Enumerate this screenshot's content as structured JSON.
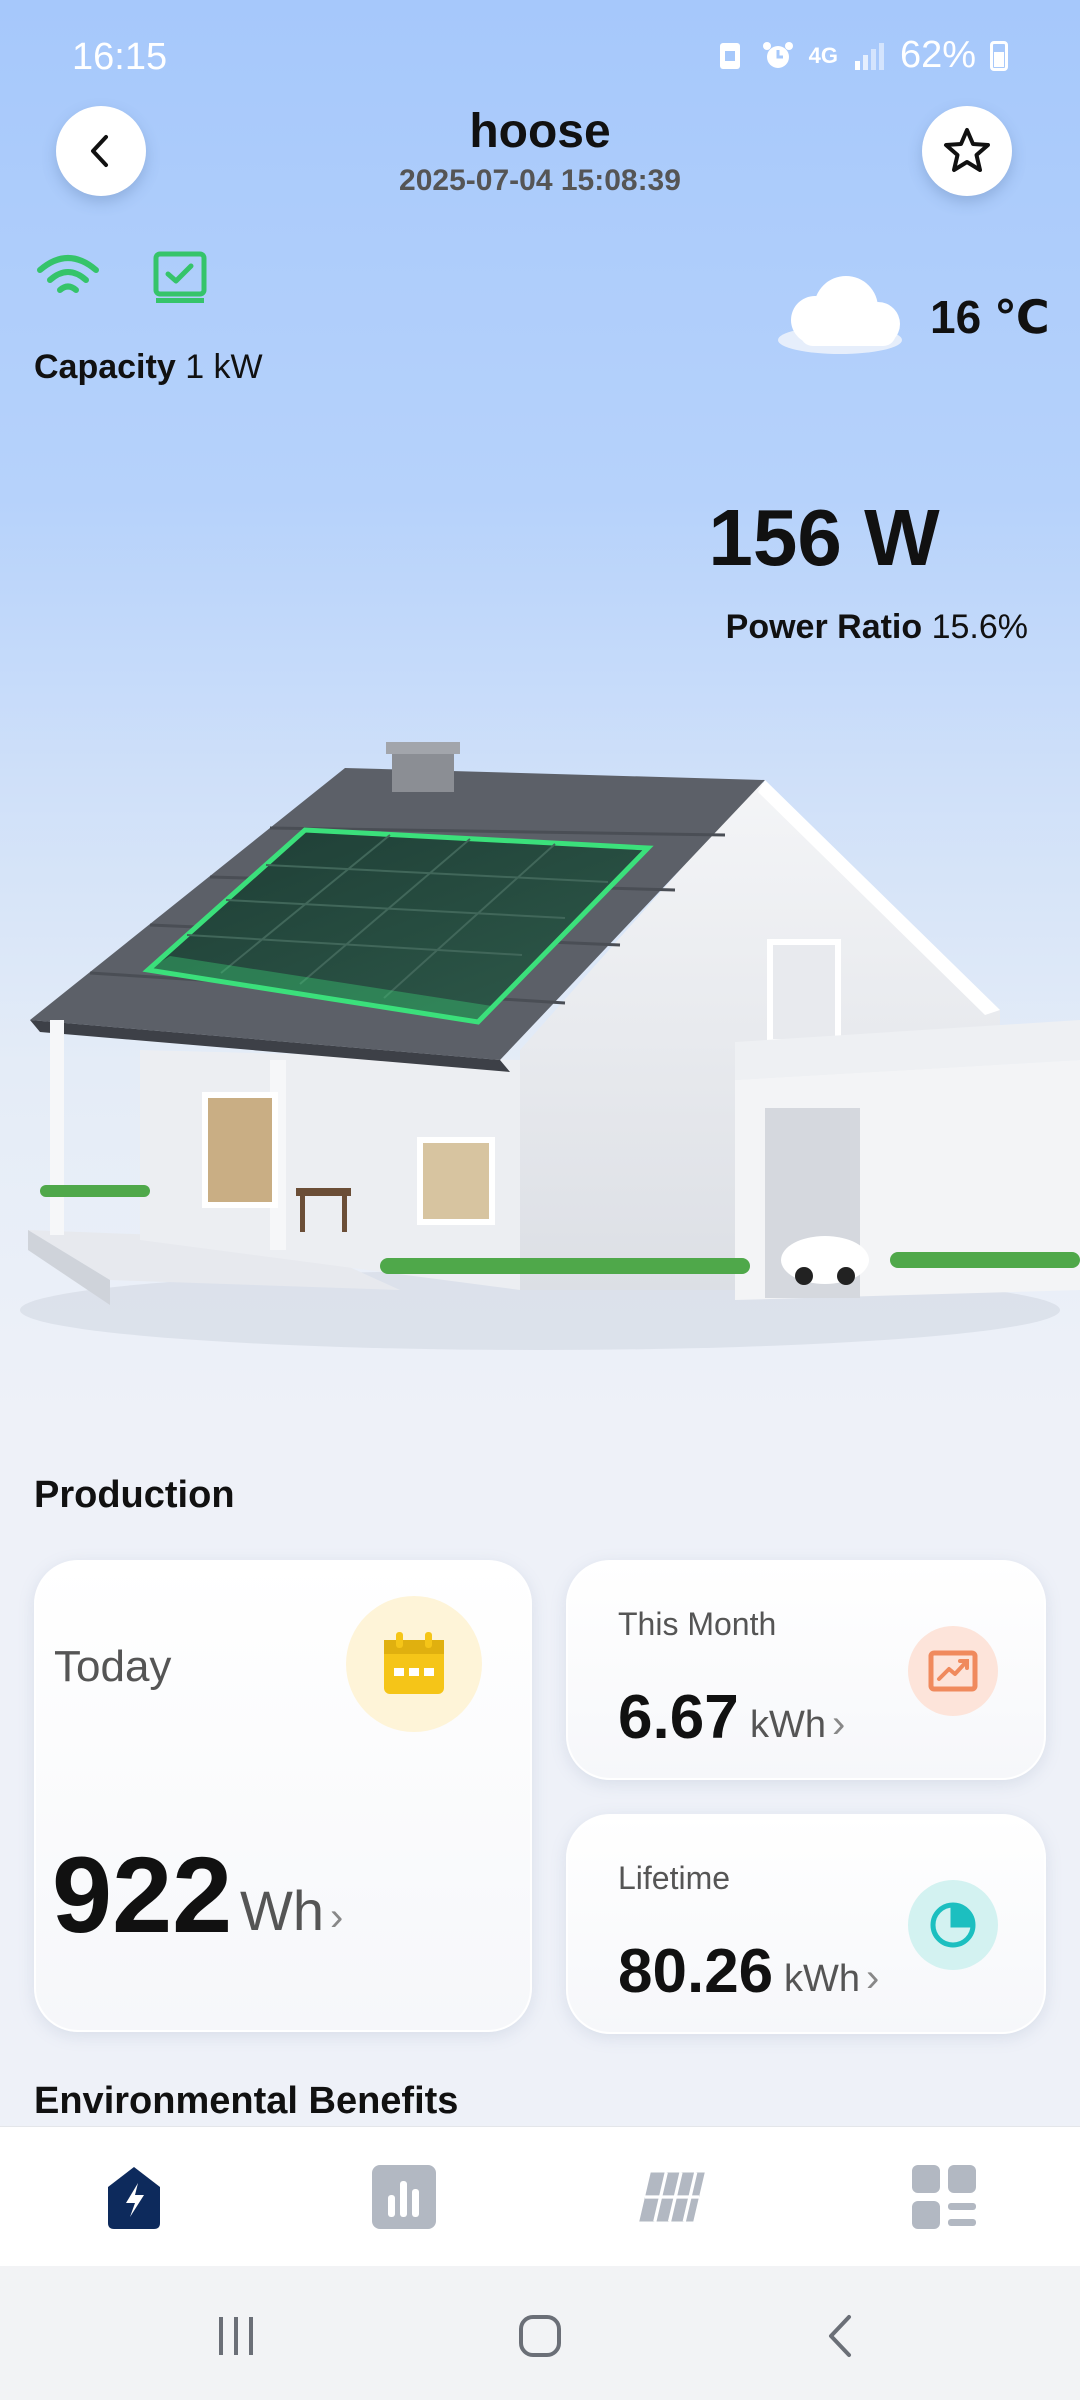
{
  "status_bar": {
    "time": "16:15",
    "network": "4G",
    "battery": "62%"
  },
  "header": {
    "title": "hoose",
    "timestamp": "2025-07-04 15:08:39"
  },
  "plant": {
    "capacity_label": "Capacity",
    "capacity_value": "1 kW",
    "temperature": "16 ℃",
    "weather_icon": "cloud-icon",
    "current_power": "156 W",
    "power_ratio_label": "Power Ratio",
    "power_ratio_value": "15.6%"
  },
  "production": {
    "title": "Production",
    "today": {
      "label": "Today",
      "value": "922",
      "unit": "Wh"
    },
    "month": {
      "label": "This Month",
      "value": "6.67",
      "unit": "kWh"
    },
    "lifetime": {
      "label": "Lifetime",
      "value": "80.26",
      "unit": "kWh"
    }
  },
  "environmental": {
    "title": "Environmental Benefits"
  },
  "tabs": [
    "power-tab",
    "statistics-tab",
    "panels-tab",
    "more-tab"
  ],
  "colors": {
    "accent": "#0d2a5c",
    "green": "#35c46a",
    "today_icon": "#f5c518",
    "month_icon": "#f08a5d",
    "life_icon": "#1cbfc0"
  }
}
